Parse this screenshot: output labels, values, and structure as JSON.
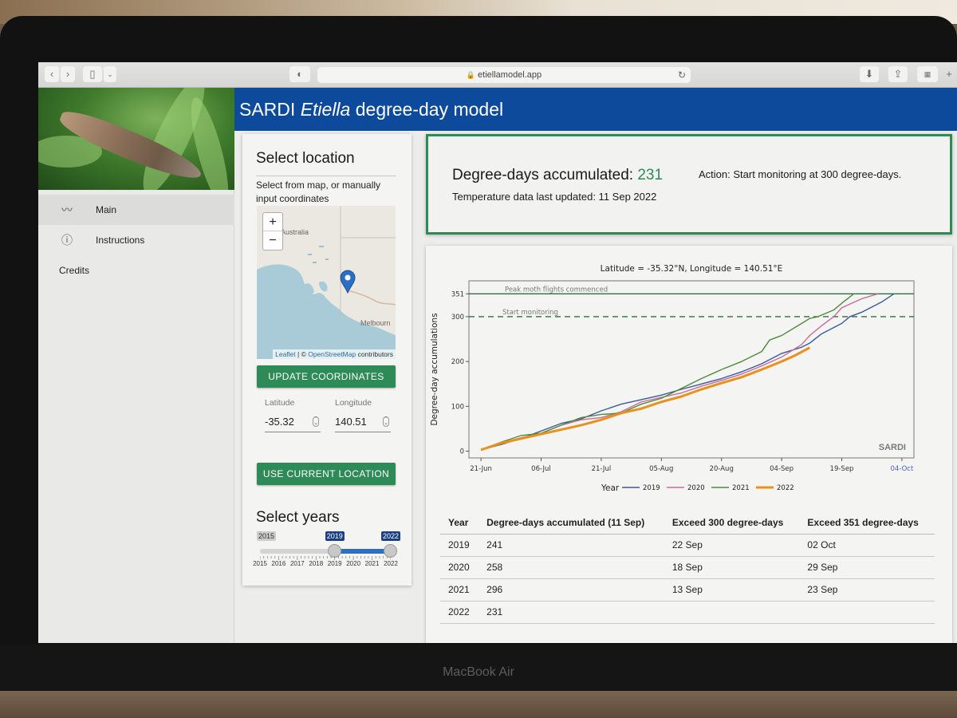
{
  "device": {
    "label": "MacBook Air"
  },
  "browser": {
    "url": "etiellamodel.app"
  },
  "app": {
    "title_prefix": "SARDI ",
    "title_italic": "Etiella",
    "title_suffix": " degree-day model"
  },
  "sidebar": {
    "items": [
      {
        "label": "Main",
        "icon": "trend-line-icon",
        "active": true
      },
      {
        "label": "Instructions",
        "icon": "info-circle-icon",
        "active": false
      },
      {
        "label": "Credits",
        "icon": "",
        "active": false
      }
    ]
  },
  "location": {
    "heading": "Select location",
    "subtitle": "Select from map, or manually input coordinates",
    "map": {
      "zoom_in": "+",
      "zoom_out": "−",
      "label_country": "Australia",
      "label_city": "Melbourn",
      "attribution_leaflet": "Leaflet",
      "attribution_sep": " | © ",
      "attribution_osm": "OpenStreetMap",
      "attribution_tail": " contributors"
    },
    "update_button": "UPDATE COORDINATES",
    "latitude_label": "Latitude",
    "latitude_value": "-35.32",
    "longitude_label": "Longitude",
    "longitude_value": "140.51",
    "current_location_button": "USE CURRENT LOCATION"
  },
  "years": {
    "heading": "Select years",
    "min": 2015,
    "max": 2022,
    "selected_from": 2019,
    "selected_to": 2022,
    "min_label": "2015",
    "from_label": "2019",
    "to_label": "2022",
    "tick_labels": [
      "2015",
      "2016",
      "2017",
      "2018",
      "2019",
      "2020",
      "2021",
      "2022"
    ]
  },
  "summary": {
    "accumulated_label": "Degree-days accumulated: ",
    "accumulated_value": "231",
    "updated_text": "Temperature data last updated: 11 Sep 2022",
    "action_text": "Action: Start monitoring at 300 degree-days."
  },
  "chart_data": {
    "type": "line",
    "title": "Latitude = -35.32°N, Longitude = 140.51°E",
    "xlabel": "",
    "ylabel": "Degree-day accumulations",
    "x_unit": "days since 21-Jun",
    "xlim": [
      -3,
      108
    ],
    "ylim": [
      -15,
      380
    ],
    "x_ticks": [
      {
        "x": 0,
        "label": "21-Jun"
      },
      {
        "x": 15,
        "label": "06-Jul"
      },
      {
        "x": 30,
        "label": "21-Jul"
      },
      {
        "x": 45,
        "label": "05-Aug"
      },
      {
        "x": 60,
        "label": "20-Aug"
      },
      {
        "x": 75,
        "label": "04-Sep"
      },
      {
        "x": 90,
        "label": "19-Sep"
      },
      {
        "x": 105,
        "label": "04-Oct"
      }
    ],
    "y_ticks": [
      0,
      100,
      200,
      300,
      351
    ],
    "reference_lines": [
      {
        "y": 351,
        "label": "Peak moth flights commenced",
        "style": "solid",
        "color": "#2f6e3e"
      },
      {
        "y": 300,
        "label": "Start monitoring",
        "style": "dashed",
        "color": "#2f6e3e"
      }
    ],
    "watermark": "SARDI",
    "legend_title": "Year",
    "legend_position": "bottom",
    "grid": false,
    "series": [
      {
        "name": "2019",
        "color": "#3b5a9a",
        "width": "thin",
        "x": [
          0,
          5,
          10,
          15,
          20,
          25,
          30,
          35,
          40,
          45,
          50,
          55,
          60,
          65,
          70,
          75,
          80,
          82,
          85,
          90,
          92,
          95,
          100,
          103
        ],
        "y": [
          3,
          15,
          28,
          45,
          62,
          72,
          90,
          105,
          115,
          125,
          138,
          150,
          162,
          177,
          195,
          218,
          232,
          241,
          262,
          285,
          300,
          310,
          333,
          351
        ]
      },
      {
        "name": "2020",
        "color": "#c86b9c",
        "width": "thin",
        "x": [
          0,
          5,
          10,
          15,
          20,
          25,
          30,
          35,
          40,
          45,
          50,
          55,
          60,
          65,
          70,
          75,
          80,
          82,
          85,
          88,
          90,
          95,
          99
        ],
        "y": [
          3,
          18,
          30,
          40,
          58,
          70,
          75,
          88,
          110,
          120,
          130,
          145,
          158,
          172,
          190,
          210,
          238,
          258,
          280,
          300,
          320,
          340,
          351
        ]
      },
      {
        "name": "2021",
        "color": "#4f8a3c",
        "width": "thin",
        "x": [
          0,
          5,
          10,
          15,
          20,
          25,
          30,
          35,
          40,
          45,
          50,
          55,
          60,
          65,
          70,
          72,
          75,
          80,
          82,
          84,
          88,
          90,
          93
        ],
        "y": [
          3,
          20,
          35,
          40,
          58,
          75,
          82,
          85,
          105,
          118,
          140,
          162,
          182,
          200,
          222,
          248,
          258,
          285,
          296,
          300,
          315,
          330,
          351
        ]
      },
      {
        "name": "2022",
        "color": "#e8911c",
        "width": "thick",
        "x": [
          0,
          5,
          10,
          15,
          20,
          25,
          30,
          35,
          40,
          45,
          50,
          55,
          60,
          65,
          70,
          75,
          78,
          82
        ],
        "y": [
          3,
          18,
          28,
          38,
          48,
          58,
          70,
          85,
          95,
          110,
          122,
          138,
          152,
          165,
          182,
          200,
          212,
          231
        ]
      }
    ]
  },
  "table": {
    "headers": [
      "Year",
      "Degree-days accumulated (11 Sep)",
      "Exceed 300 degree-days",
      "Exceed 351 degree-days"
    ],
    "rows": [
      [
        "2019",
        "241",
        "22 Sep",
        "02 Oct"
      ],
      [
        "2020",
        "258",
        "18 Sep",
        "29 Sep"
      ],
      [
        "2021",
        "296",
        "13 Sep",
        "23 Sep"
      ],
      [
        "2022",
        "231",
        "",
        ""
      ]
    ]
  }
}
